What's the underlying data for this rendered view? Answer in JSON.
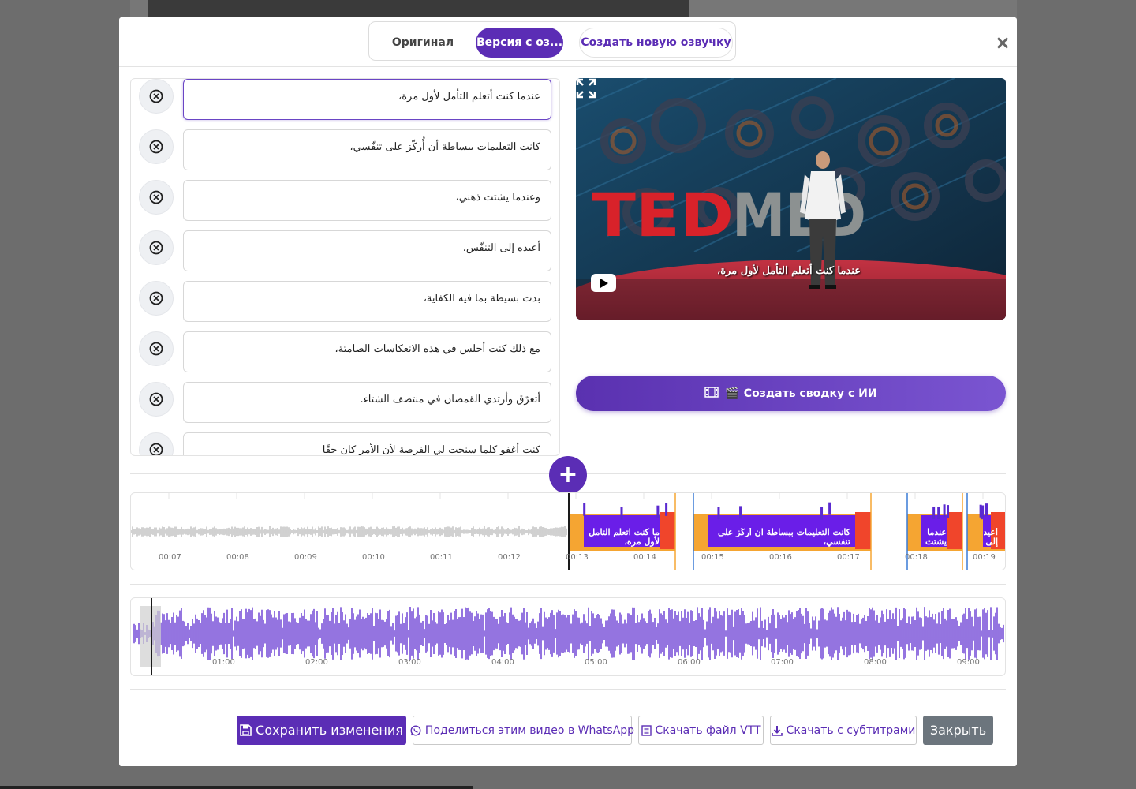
{
  "tabs": {
    "original": "Оригинал",
    "version": "Версия с оз...",
    "create_voice": "Создать новую озвучку"
  },
  "close_symbol": "×",
  "subtitles": [
    "عندما كنت أتعلم التأمل لأول مرة،",
    "كانت التعليمات ببساطة أن أُركّز على تنفّسي،",
    "وعندما يشتت ذهني،",
    "أعيده إلى التنفّس.",
    "بدت بسيطة بما فيه الكفاية،",
    "مع ذلك كنت أجلس في هذه الانعكاسات الصامتة،",
    "أتعرّق وأرتدي القمصان في منتصف الشتاء.",
    "كنت أغفو كلما سنحت لي الفرصة لأن الأمر كان حقًا"
  ],
  "video": {
    "caption": "عندما كنت أتعلم التأمل لأول مرة،",
    "logo_text": "TEDMED"
  },
  "ai_button": {
    "icon": "🎬",
    "label": "Создать сводку с ИИ"
  },
  "add_symbol": "+",
  "timeline": {
    "ticks": [
      "00:07",
      "00:08",
      "00:09",
      "00:10",
      "00:11",
      "00:12",
      "00:13",
      "00:14",
      "00:15",
      "00:16",
      "00:17",
      "00:18",
      "00:19"
    ],
    "segments": [
      "ما كنت اتعلم التامل لأول مرة،",
      "كانت التعليمات ببساطة ان أُركّز على تنفسي،",
      "عندما يشتت",
      "أعيده إلى"
    ]
  },
  "overview": {
    "ticks": [
      "01:00",
      "02:00",
      "03:00",
      "04:00",
      "05:00",
      "06:00",
      "07:00",
      "08:00",
      "09:00"
    ]
  },
  "colors": {
    "accent": "#5b2db5",
    "segment_orange": "#f5a532",
    "segment_red": "#f0452b",
    "segment_purple": "#6a1ee8",
    "wave_purple": "#5a2ad0",
    "close_gray": "#6c757d"
  },
  "footer": {
    "save": "Сохранить изменения",
    "whatsapp": "Поделиться этим видео в WhatsApp",
    "vtt": "Скачать файл VTT",
    "download": "Скачать с субтитрами",
    "close": "Закрыть"
  }
}
